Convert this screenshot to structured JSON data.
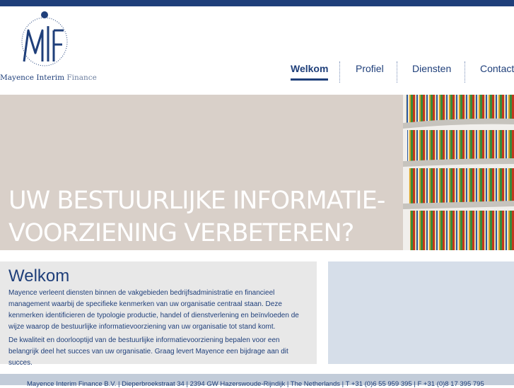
{
  "brand": {
    "company_name": "Mayence Interim Finance",
    "name_strong": "Mayence Interim",
    "name_light": "Finance",
    "colors": {
      "primary": "#1f3f7a",
      "hero_bg": "#d9d0c9",
      "panel_bg": "#e8e8e8",
      "side_panel_bg": "#d6dee9",
      "footer_bg": "#c2ccd9"
    }
  },
  "nav": {
    "items": [
      {
        "label": "Welkom",
        "active": true
      },
      {
        "label": "Profiel",
        "active": false
      },
      {
        "label": "Diensten",
        "active": false
      },
      {
        "label": "Contact",
        "active": false
      }
    ]
  },
  "hero": {
    "line1": "UW BESTUURLIJKE INFORMATIE-",
    "line2": "VOORZIENING VERBETEREN?",
    "image_icon": "file-shelves-photo"
  },
  "welcome": {
    "heading": "Welkom",
    "paragraph1": "Mayence verleent diensten binnen de vakgebieden bedrijfsadministratie en financieel management waarbij de specifieke kenmerken van uw organisatie centraal staan. Deze kenmerken identificieren de typologie productie, handel of dienstverlening en beïnvloeden de wijze waarop de bestuurlijke informatievoorziening van uw organisatie tot stand komt.",
    "paragraph2": "De kwaliteit en doorlooptijd van de bestuurlijke informatievoorziening bepalen voor een belangrijk deel het succes van uw organisatie. Graag levert Mayence een bijdrage aan dit succes."
  },
  "footer": {
    "text": "Mayence Interim Finance B.V. | Dieperbroekstraat 34 | 2394 GW Hazerswoude-Rijndijk | The Netherlands | T +31 (0)6 55 959 395 | F +31 (0)8 17 395 795"
  }
}
